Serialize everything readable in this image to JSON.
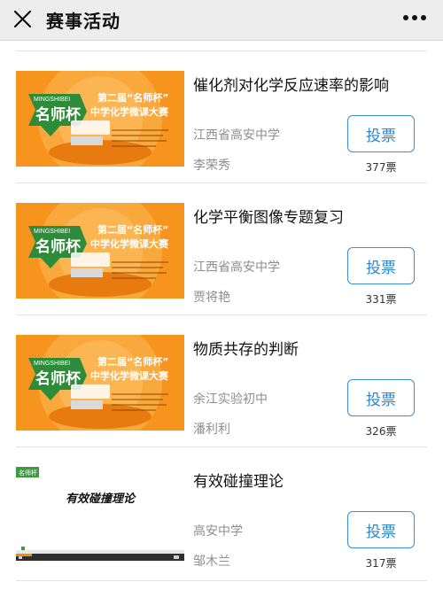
{
  "header": {
    "title": "赛事活动"
  },
  "poster": {
    "logo_top": "MINGSHIBEI",
    "logo_main": "名师杯",
    "headline_1": "第二届“名师杯”",
    "headline_2": "中学化学微课大赛"
  },
  "items": [
    {
      "title": "催化剂对化学反应速率的影响",
      "school": "江西省高安中学",
      "author": "李荣秀",
      "vote_label": "投票",
      "votes": "377票"
    },
    {
      "title": "化学平衡图像专题复习",
      "school": "江西省高安中学",
      "author": "贾将艳",
      "vote_label": "投票",
      "votes": "331票"
    },
    {
      "title": "物质共存的判断",
      "school": "余江实验初中",
      "author": "潘利利",
      "vote_label": "投票",
      "votes": "326票"
    },
    {
      "title": "有效碰撞理论",
      "school": "高安中学",
      "author": "邹木兰",
      "vote_label": "投票",
      "votes": "317票"
    }
  ],
  "slide": {
    "badge": "名师杯",
    "title": "有效碰撞理论"
  },
  "colors": {
    "accent": "#3a8fd4",
    "poster_orange": "#f7941d",
    "poster_green": "#2e8b3a"
  }
}
